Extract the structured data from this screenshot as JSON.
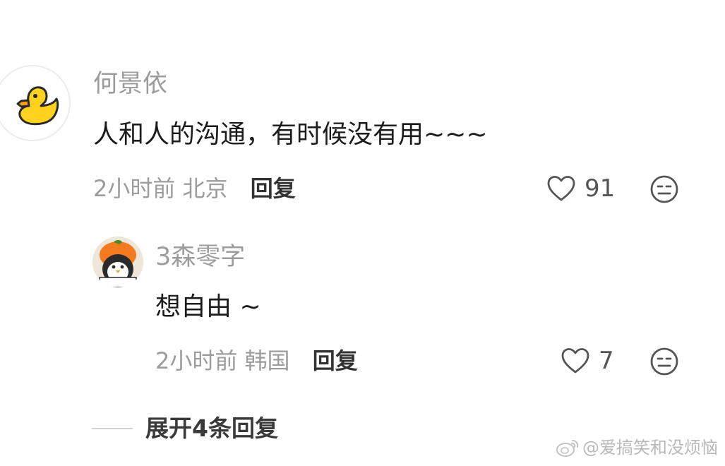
{
  "comment": {
    "avatar": "yellow-duck-avatar",
    "username": "何景依",
    "text": "人和人的沟通，有时候没有用~~~",
    "time": "2小时前",
    "location": "北京",
    "reply_label": "回复",
    "likes": "91",
    "like_icon": "heart-outline-icon",
    "dislike_icon": "neutral-face-icon"
  },
  "reply": {
    "avatar": "penguin-pumpkin-hat-avatar",
    "username": "3森零字",
    "text": "想自由 ~",
    "time": "2小时前",
    "location": "韩国",
    "reply_label": "回复",
    "likes": "7",
    "like_icon": "heart-outline-icon",
    "dislike_icon": "neutral-face-icon"
  },
  "expand": {
    "label": "展开4条回复"
  },
  "watermark": {
    "text": "@爱搞笑和没烦恼",
    "icon": "weibo-logo-icon"
  },
  "colors": {
    "name": "#9c9c9c",
    "text": "#1c1c1c",
    "meta": "#9c9c9c",
    "icon": "#555555",
    "duck": "#ffd21f"
  }
}
